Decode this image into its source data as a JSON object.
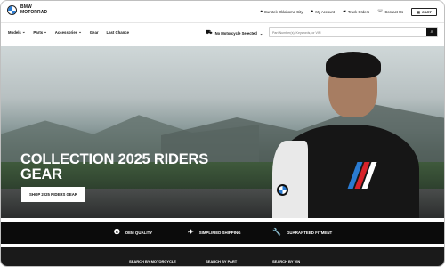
{
  "brand": {
    "line1": "BMW",
    "line2": "MOTORRAD"
  },
  "utility": {
    "location": "Eurotek Oklahoma City",
    "account": "My Account",
    "track": "Track Orders",
    "contact": "Contact Us",
    "cart": "CART"
  },
  "nav": {
    "items": [
      "Models",
      "Parts",
      "Accessories",
      "Gear",
      "Last Chance"
    ],
    "motorcycle_select": "No Motorcycle Selected",
    "search_placeholder": "Part Number(s), Keywords, or VIN"
  },
  "hero": {
    "title_line1": "COLLECTION 2025 RIDERS",
    "title_line2": "GEAR",
    "cta": "SHOP 2025 RIDERS GEAR"
  },
  "features": [
    "OEM QUALITY",
    "SIMPLIFIED SHIPPING",
    "GUARANTEED FITMENT"
  ],
  "search_tabs": [
    "SEARCH BY MOTORCYCLE",
    "SEARCH BY PART",
    "SEARCH BY VIN"
  ],
  "colors": {
    "accent": "#2a7bd1",
    "dark": "#0b0b0b"
  },
  "icons": [
    "location-icon",
    "user-icon",
    "truck-icon",
    "phone-icon",
    "cart-icon",
    "motorcycle-icon",
    "search-icon",
    "badge-icon",
    "shipping-icon",
    "wrench-icon"
  ]
}
